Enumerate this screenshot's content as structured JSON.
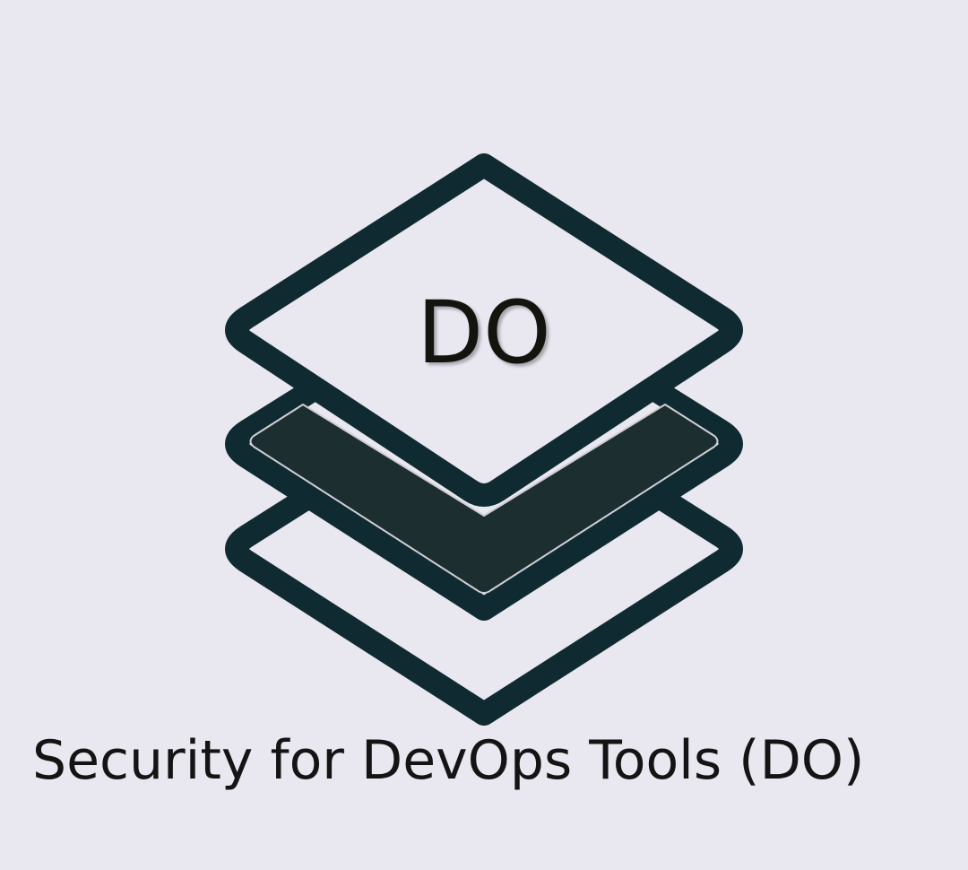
{
  "logo": {
    "initials": "DO",
    "icon": "stacked-layers-icon",
    "colors": {
      "background": "#e9e7ef",
      "outline": "#0f2a30",
      "middle_fill": "#1d2e30",
      "layer_fill": "#e9e7ef"
    }
  },
  "caption": {
    "text": "Security for DevOps Tools (DO)"
  }
}
